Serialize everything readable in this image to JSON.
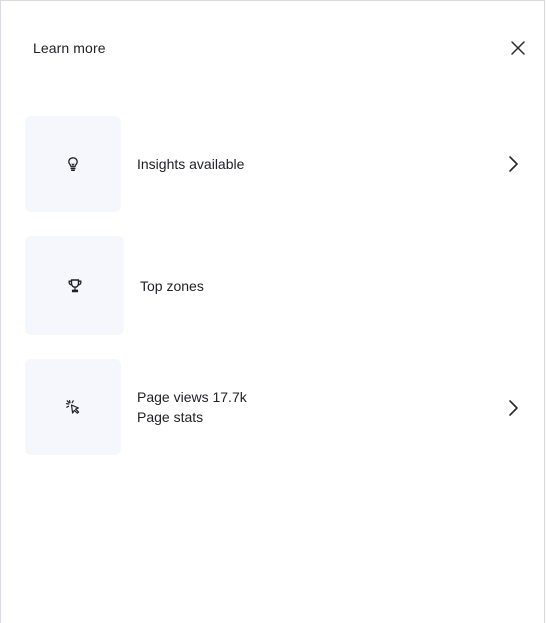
{
  "header": {
    "title": "Learn more",
    "close_icon": "close-icon"
  },
  "items": [
    {
      "icon": "lightbulb-icon",
      "label": "Insights available",
      "has_chevron": true
    },
    {
      "icon": "trophy-icon",
      "label": "Top zones",
      "has_chevron": false
    },
    {
      "icon": "cursor-click-icon",
      "label": "Page views 17.7k",
      "sublabel": "Page stats",
      "has_chevron": true
    }
  ],
  "colors": {
    "tile_background": "#f6f6fd",
    "text": "#1f1f24",
    "border": "#d9d9df"
  }
}
